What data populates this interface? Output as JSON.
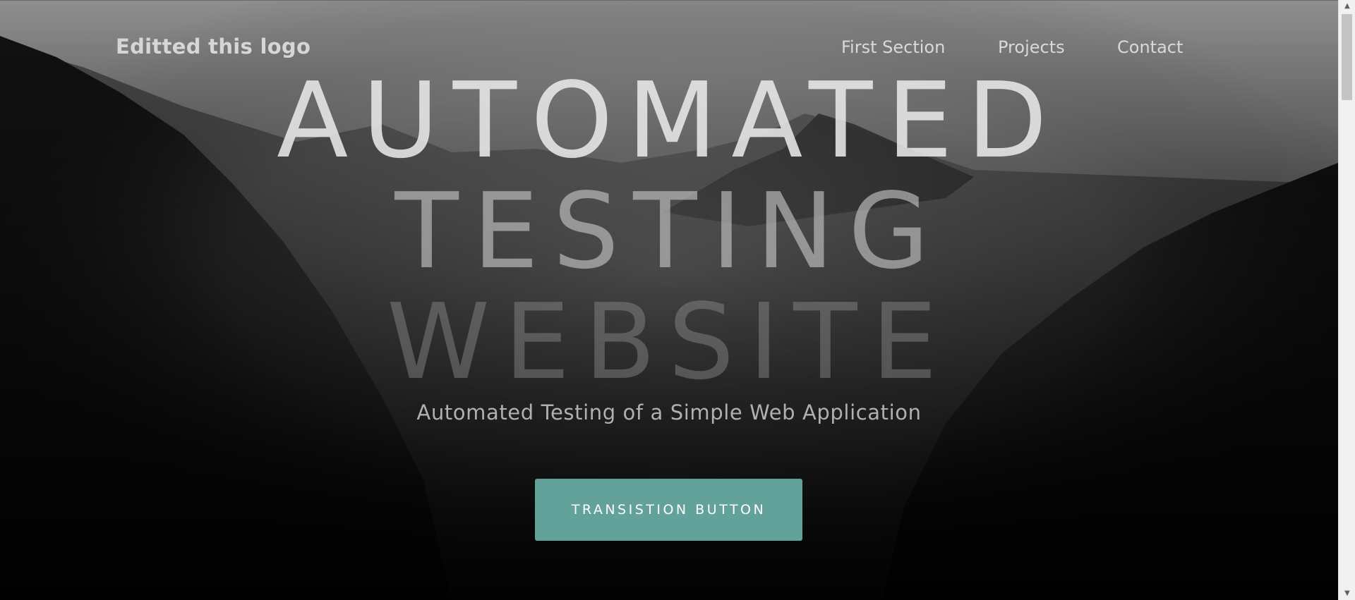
{
  "header": {
    "logo": "Editted this logo",
    "nav": [
      {
        "label": "First Section"
      },
      {
        "label": "Projects"
      },
      {
        "label": "Contact"
      }
    ]
  },
  "hero": {
    "headline_lines": [
      "AUTOMATED",
      "TESTING",
      "WEBSITE"
    ],
    "subtitle": "Automated Testing of a Simple Web Application",
    "button_label": "TRANSISTION BUTTON"
  },
  "colors": {
    "accent": "#62a29a",
    "logo_text": "#d6d6d6",
    "nav_text": "#d9d9d9",
    "subtitle_text": "#b0b0b0"
  },
  "scrollbar": {
    "up_icon": "chevron-up-icon",
    "down_icon": "chevron-down-icon"
  }
}
